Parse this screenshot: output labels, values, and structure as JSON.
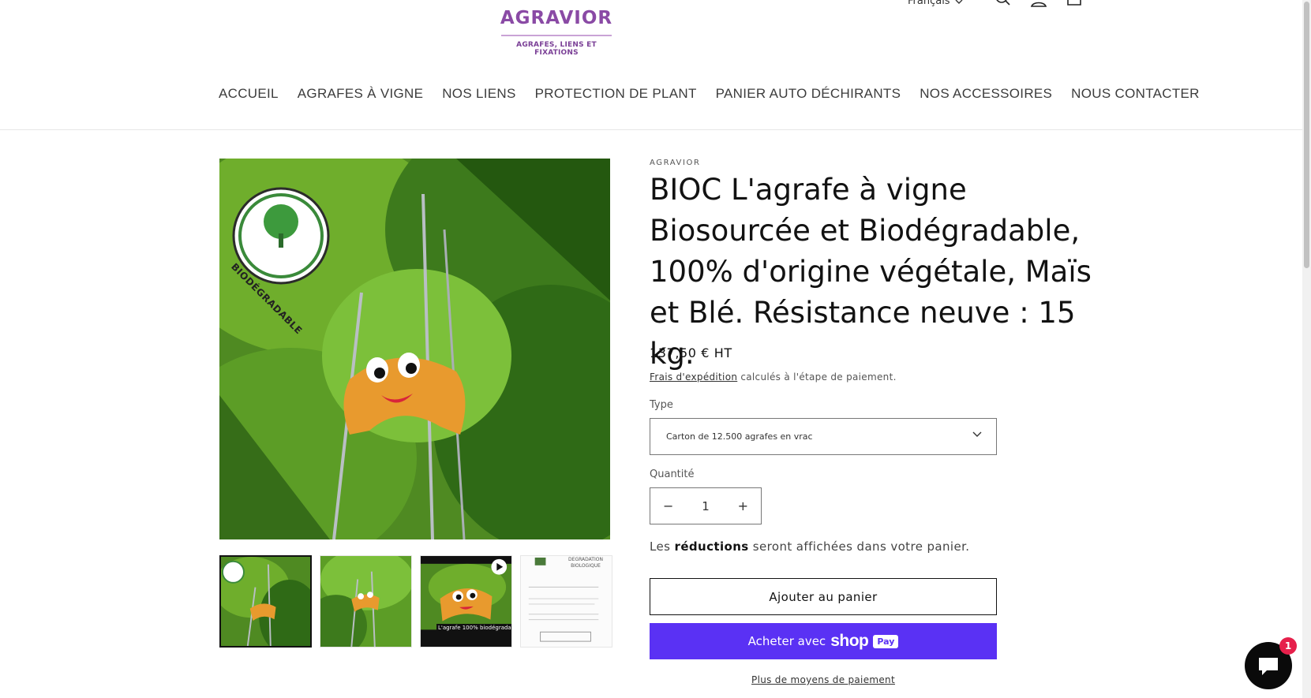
{
  "header": {
    "logo_text": "AGRAVIOR",
    "logo_tagline": "AGRAFES, LIENS ET FIXATIONS",
    "language": "Français",
    "icons": [
      "chevron-down-icon",
      "search-icon",
      "account-icon",
      "cart-icon"
    ]
  },
  "nav": {
    "items": [
      {
        "label": "ACCUEIL"
      },
      {
        "label": "AGRAFES À VIGNE"
      },
      {
        "label": "NOS LIENS"
      },
      {
        "label": "PROTECTION DE PLANT"
      },
      {
        "label": "PANIER AUTO DÉCHIRANTS"
      },
      {
        "label": "NOS ACCESSOIRES"
      },
      {
        "label": "NOUS CONTACTER"
      }
    ]
  },
  "gallery": {
    "badge_text": "BIODÉGRADABLE",
    "thumbs": [
      {
        "caption": ""
      },
      {
        "caption": ""
      },
      {
        "caption": "L'agrafe 100% biodégradable"
      },
      {
        "caption": "DEGRADATION BIOLOGIQUE"
      }
    ]
  },
  "product": {
    "vendor": "AGRAVIOR",
    "title": "BIOC L'agrafe à vigne Biosourcée et Biodégradable, 100% d'origine végétale, Maïs et Blé. Résistance neuve : 15 kg.",
    "price": "137,50 € HT",
    "shipping_link": "Frais d'expédition",
    "shipping_text": " calculés à l'étape de paiement.",
    "type_label": "Type",
    "type_value": "Carton de 12.500 agrafes en vrac",
    "quantity_label": "Quantité",
    "quantity_value": "1",
    "discount_prefix": "Les ",
    "discount_bold": "réductions",
    "discount_suffix": " seront affichées dans votre panier.",
    "add_to_cart": "Ajouter au panier",
    "buy_prefix": "Acheter avec",
    "buy_brand": "shop",
    "buy_badge": "Pay",
    "more_payment": "Plus de moyens de paiement"
  },
  "chat": {
    "badge_count": "1"
  },
  "colors": {
    "brand_purple": "#8a4aa5",
    "shop_pay": "#5a31f4",
    "chat_badge": "#e6204b"
  }
}
